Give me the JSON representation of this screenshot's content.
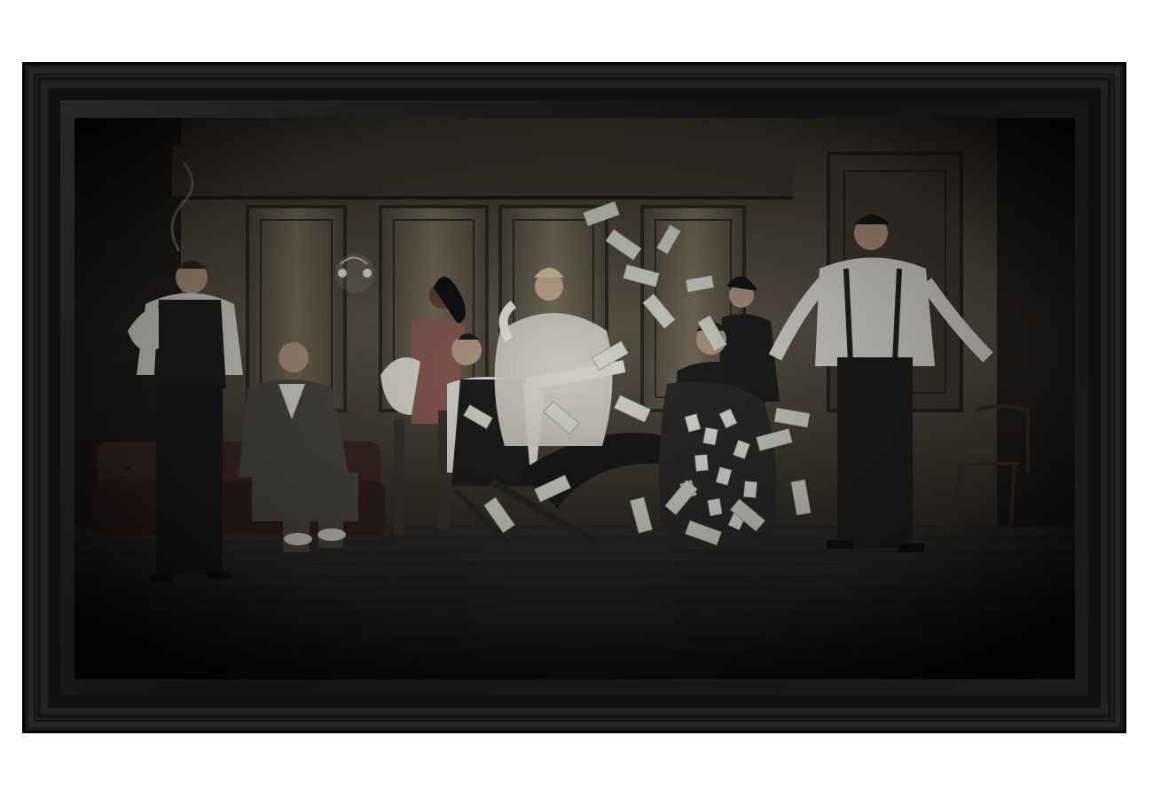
{
  "artwork": {
    "frame_color": "#141415",
    "palette": {
      "wall_light": "#6e6552",
      "wall_dark": "#2a241d",
      "floor": "#1e1d1b",
      "sofa": "#3a2420",
      "banknote": "#d9dccf"
    }
  }
}
